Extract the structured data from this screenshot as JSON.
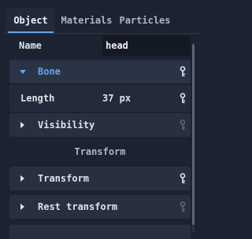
{
  "tabs": [
    {
      "label": "Object",
      "active": true
    },
    {
      "label": "Materials",
      "active": false
    },
    {
      "label": "Particles",
      "active": false
    }
  ],
  "name_row": {
    "label": "Name",
    "value": "head"
  },
  "sections": {
    "bone": {
      "label": "Bone",
      "expanded": true
    },
    "visibility": {
      "label": "Visibility",
      "expanded": false
    },
    "transform": {
      "label": "Transform",
      "expanded": false
    },
    "rest_transform": {
      "label": "Rest transform",
      "expanded": false
    }
  },
  "length_row": {
    "label": "Length",
    "value": "37 px"
  },
  "transform_heading": "Transform",
  "colors": {
    "accent": "#6aa3e8",
    "panel": "#1c2230",
    "field": "#141925",
    "section": "#28303f"
  },
  "icons": {
    "key": "key-icon",
    "key_dim": "key-icon-disabled",
    "expand": "chevron-right-icon",
    "collapse": "chevron-down-icon"
  }
}
